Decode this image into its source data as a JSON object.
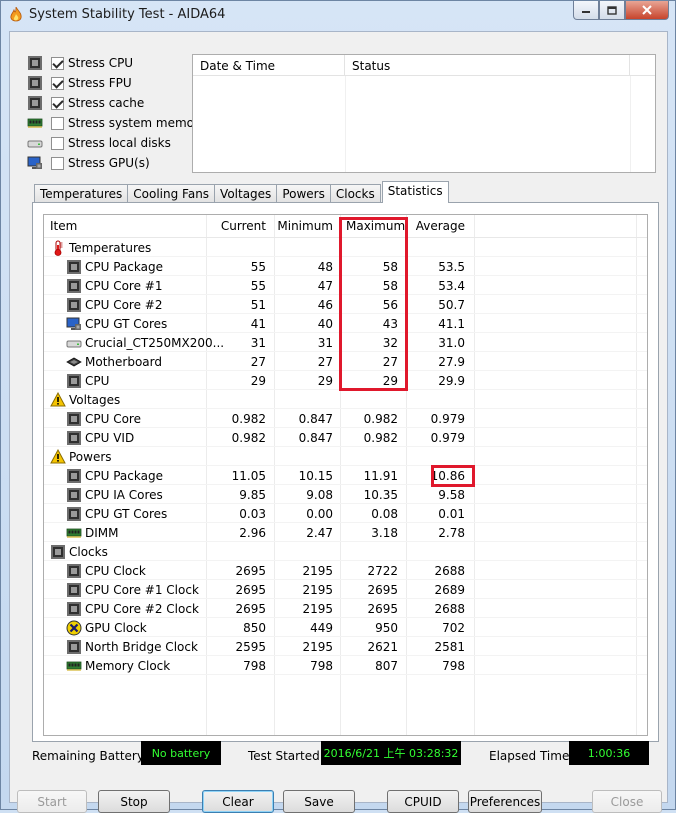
{
  "window": {
    "title": "System Stability Test - AIDA64",
    "caption_buttons": [
      "minimize-icon",
      "maximize-icon",
      "close-icon"
    ]
  },
  "stress": [
    {
      "label": "Stress CPU",
      "checked": true,
      "icon": "cpu-chip-icon"
    },
    {
      "label": "Stress FPU",
      "checked": true,
      "icon": "fpu-chip-icon"
    },
    {
      "label": "Stress cache",
      "checked": true,
      "icon": "cache-chip-icon"
    },
    {
      "label": "Stress system memory",
      "checked": false,
      "icon": "memory-module-icon"
    },
    {
      "label": "Stress local disks",
      "checked": false,
      "icon": "disk-drive-icon"
    },
    {
      "label": "Stress GPU(s)",
      "checked": false,
      "icon": "monitor-gpu-icon"
    }
  ],
  "log": {
    "col_datetime": "Date & Time",
    "col_status": "Status"
  },
  "tabs": [
    "Temperatures",
    "Cooling Fans",
    "Voltages",
    "Powers",
    "Clocks",
    "Statistics"
  ],
  "active_tab": "Statistics",
  "stats": {
    "headers": {
      "item": "Item",
      "current": "Current",
      "minimum": "Minimum",
      "maximum": "Maximum",
      "average": "Average"
    },
    "rows": [
      {
        "type": "group",
        "label": "Temperatures",
        "icon": "thermometer-icon"
      },
      {
        "type": "item",
        "label": "CPU Package",
        "icon": "chip-icon",
        "current": "55",
        "minimum": "48",
        "maximum": "58",
        "average": "53.5"
      },
      {
        "type": "item",
        "label": "CPU Core #1",
        "icon": "chip-icon",
        "current": "55",
        "minimum": "47",
        "maximum": "58",
        "average": "53.4"
      },
      {
        "type": "item",
        "label": "CPU Core #2",
        "icon": "chip-icon",
        "current": "51",
        "minimum": "46",
        "maximum": "56",
        "average": "50.7"
      },
      {
        "type": "item",
        "label": "CPU GT Cores",
        "icon": "monitor-gpu-icon",
        "current": "41",
        "minimum": "40",
        "maximum": "43",
        "average": "41.1"
      },
      {
        "type": "item",
        "label": "Crucial_CT250MX200...",
        "icon": "disk-drive-icon",
        "current": "31",
        "minimum": "31",
        "maximum": "32",
        "average": "31.0"
      },
      {
        "type": "item",
        "label": "Motherboard",
        "icon": "motherboard-icon",
        "current": "27",
        "minimum": "27",
        "maximum": "27",
        "average": "27.9"
      },
      {
        "type": "item",
        "label": "CPU",
        "icon": "chip-icon",
        "current": "29",
        "minimum": "29",
        "maximum": "29",
        "average": "29.9"
      },
      {
        "type": "group",
        "label": "Voltages",
        "icon": "warning-icon"
      },
      {
        "type": "item",
        "label": "CPU Core",
        "icon": "chip-icon",
        "current": "0.982",
        "minimum": "0.847",
        "maximum": "0.982",
        "average": "0.979"
      },
      {
        "type": "item",
        "label": "CPU VID",
        "icon": "chip-icon",
        "current": "0.982",
        "minimum": "0.847",
        "maximum": "0.982",
        "average": "0.979"
      },
      {
        "type": "group",
        "label": "Powers",
        "icon": "warning-icon"
      },
      {
        "type": "item",
        "label": "CPU Package",
        "icon": "chip-icon",
        "current": "11.05",
        "minimum": "10.15",
        "maximum": "11.91",
        "average": "10.86"
      },
      {
        "type": "item",
        "label": "CPU IA Cores",
        "icon": "chip-icon",
        "current": "9.85",
        "minimum": "9.08",
        "maximum": "10.35",
        "average": "9.58"
      },
      {
        "type": "item",
        "label": "CPU GT Cores",
        "icon": "chip-icon",
        "current": "0.03",
        "minimum": "0.00",
        "maximum": "0.08",
        "average": "0.01"
      },
      {
        "type": "item",
        "label": "DIMM",
        "icon": "memory-module-icon",
        "current": "2.96",
        "minimum": "2.47",
        "maximum": "3.18",
        "average": "2.78"
      },
      {
        "type": "group",
        "label": "Clocks",
        "icon": "clock-chip-icon"
      },
      {
        "type": "item",
        "label": "CPU Clock",
        "icon": "chip-icon",
        "current": "2695",
        "minimum": "2195",
        "maximum": "2722",
        "average": "2688"
      },
      {
        "type": "item",
        "label": "CPU Core #1 Clock",
        "icon": "chip-icon",
        "current": "2695",
        "minimum": "2195",
        "maximum": "2695",
        "average": "2689"
      },
      {
        "type": "item",
        "label": "CPU Core #2 Clock",
        "icon": "chip-icon",
        "current": "2695",
        "minimum": "2195",
        "maximum": "2695",
        "average": "2688"
      },
      {
        "type": "item",
        "label": "GPU Clock",
        "icon": "xbox-gpu-icon",
        "current": "850",
        "minimum": "449",
        "maximum": "950",
        "average": "702"
      },
      {
        "type": "item",
        "label": "North Bridge Clock",
        "icon": "chip-icon",
        "current": "2595",
        "minimum": "2195",
        "maximum": "2621",
        "average": "2581"
      },
      {
        "type": "item",
        "label": "Memory Clock",
        "icon": "memory-module-icon",
        "current": "798",
        "minimum": "798",
        "maximum": "807",
        "average": "798"
      }
    ]
  },
  "status": {
    "battery_label": "Remaining Battery:",
    "battery_value": "No battery",
    "started_label": "Test Started:",
    "started_value": "2016/6/21 上午 03:28:32",
    "elapsed_label": "Elapsed Time:",
    "elapsed_value": "1:00:36"
  },
  "buttons": {
    "start": "Start",
    "stop": "Stop",
    "clear": "Clear",
    "save": "Save",
    "cpuid": "CPUID",
    "preferences": "Preferences",
    "close": "Close"
  },
  "colors": {
    "highlight": "#e0182c",
    "lcd_text": "#32ff32",
    "lcd_bg": "#000000"
  }
}
